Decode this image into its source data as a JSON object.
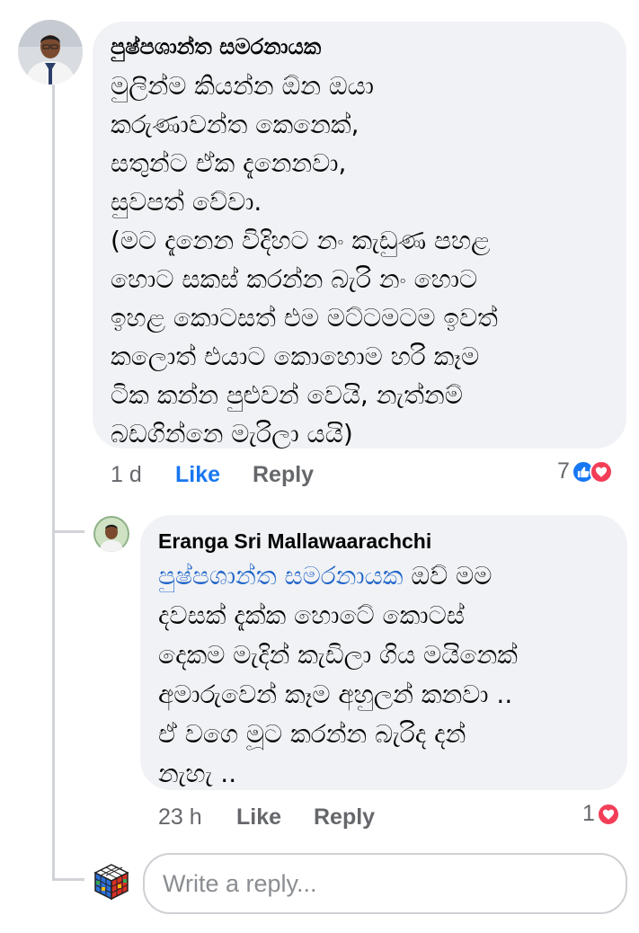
{
  "comment": {
    "author": "පුෂ්පශාන්ත සමරනායක",
    "lines": [
      "මුලින්ම කියන්න ඕන ඔයා",
      "කරුණාවන්ත කෙනෙක්,",
      "සතුන්ට ඒක දැනෙනවා,",
      "සුවපත් වේවා.",
      "(මට දැනෙන විදිහට නං කැඩුණ පහළ",
      "හොට සකස් කරන්න බැරි නං හොට",
      "ඉහළ කොටසත් එම මට්ටමටම ඉවත්",
      "කලොත් එයාට කොහොම හරි කෑම",
      "ටික කන්න පුළුවන් වෙයි, නැත්නම්",
      "බඩගින්නෙ මැරිලා යයි)"
    ],
    "time": "1 d",
    "like_label": "Like",
    "reply_label": "Reply",
    "reaction_count": "7",
    "reaction_icons": [
      "like-icon",
      "love-icon"
    ]
  },
  "reply": {
    "author": "Eranga Sri Mallawaarachchi",
    "mention": "පුෂ්පශාන්ත සමරනායක",
    "first_line_rest": " ඔව්  මම",
    "lines": [
      "දවසක් දැක්ක හොටේ කොටස්",
      "දෙකම මැදින් කැඩිලා ගිය මයිනෙක්",
      "අමාරුවෙන් කෑම අහුලන් කනවා ..",
      "ඒ වගෙ මූට කරන්න බැරිද දන්",
      "නැහැ .."
    ],
    "time": "23 h",
    "like_label": "Like",
    "reply_label": "Reply",
    "reaction_count": "1",
    "reaction_icons": [
      "love-icon"
    ]
  },
  "composer": {
    "placeholder": "Write a reply..."
  },
  "colors": {
    "bubble": "#f0f2f5",
    "link": "#1877f2",
    "muted": "#65676b",
    "love": "#f33e58"
  }
}
